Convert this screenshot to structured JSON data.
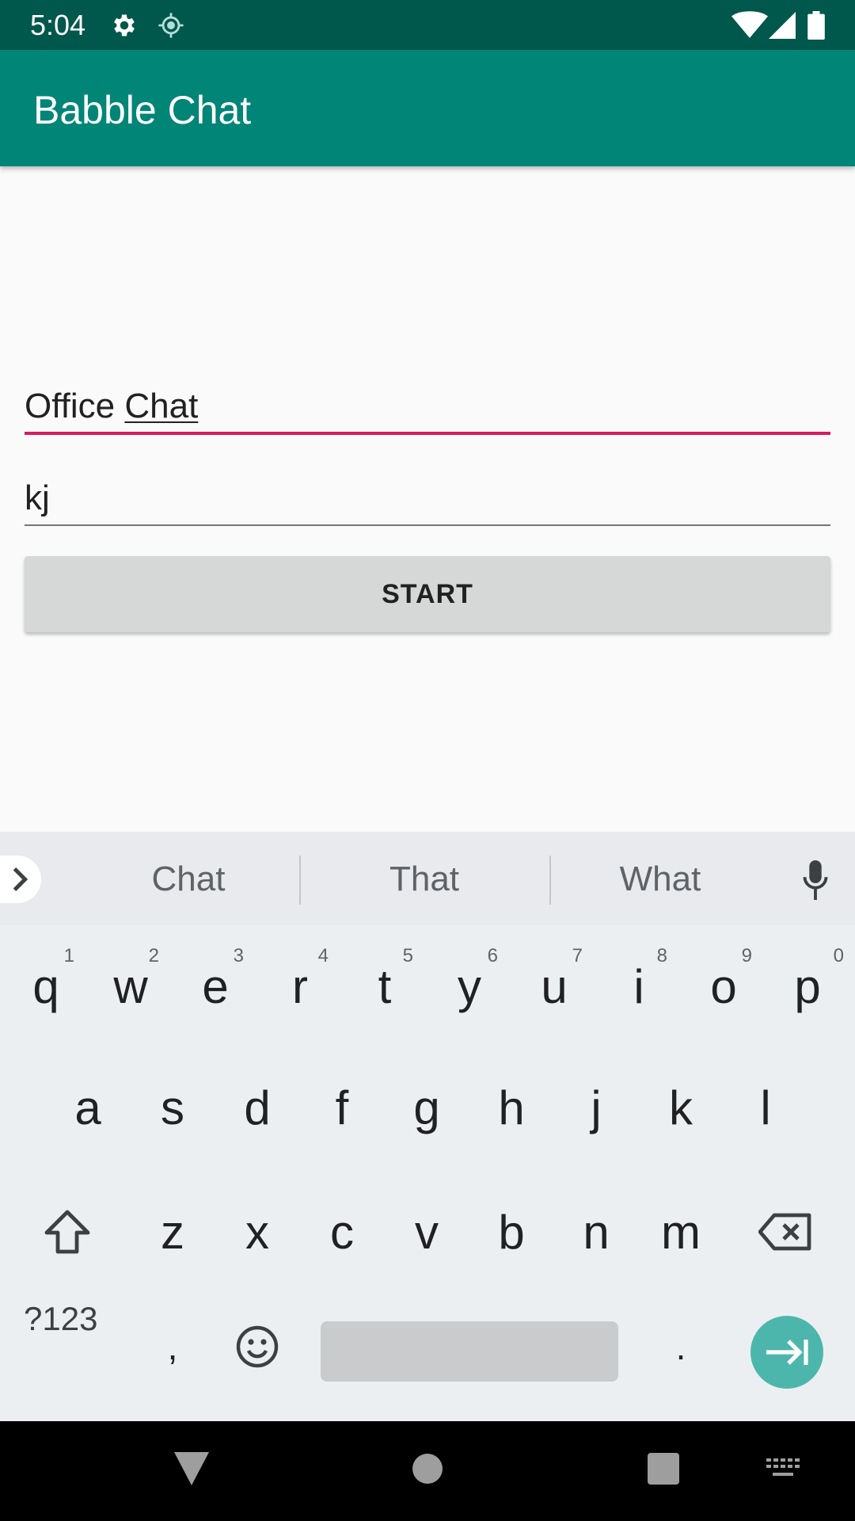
{
  "status_bar": {
    "time": "5:04",
    "icons": [
      "settings-icon",
      "location-icon",
      "wifi-icon",
      "signal-icon",
      "battery-icon"
    ]
  },
  "app_bar": {
    "title": "Babble Chat"
  },
  "form": {
    "room_name_prefix": "Office ",
    "room_name_composing": "Chat",
    "username": "kj",
    "start_label": "START"
  },
  "keyboard": {
    "suggestions": [
      "Chat",
      "That",
      "What"
    ],
    "row1": [
      "q",
      "w",
      "e",
      "r",
      "t",
      "y",
      "u",
      "i",
      "o",
      "p"
    ],
    "row1_hints": [
      "1",
      "2",
      "3",
      "4",
      "5",
      "6",
      "7",
      "8",
      "9",
      "0"
    ],
    "row2": [
      "a",
      "s",
      "d",
      "f",
      "g",
      "h",
      "j",
      "k",
      "l"
    ],
    "row3": [
      "z",
      "x",
      "c",
      "v",
      "b",
      "n",
      "m"
    ],
    "symbols_label": "?123",
    "comma": ",",
    "period": "."
  },
  "colors": {
    "status_bar": "#00574b",
    "app_bar": "#008577",
    "accent": "#d81b60",
    "enter_key": "#4db6ac"
  }
}
